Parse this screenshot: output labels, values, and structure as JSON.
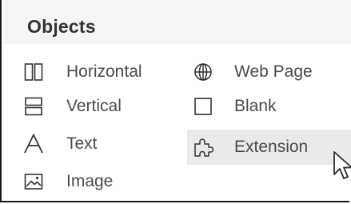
{
  "panel": {
    "title": "Objects"
  },
  "objects": {
    "horizontal": {
      "label": "Horizontal",
      "icon": "horizontal-layout-icon"
    },
    "vertical": {
      "label": "Vertical",
      "icon": "vertical-layout-icon"
    },
    "text": {
      "label": "Text",
      "icon": "text-icon"
    },
    "image": {
      "label": "Image",
      "icon": "image-icon"
    },
    "web_page": {
      "label": "Web Page",
      "icon": "globe-icon"
    },
    "blank": {
      "label": "Blank",
      "icon": "blank-icon"
    },
    "extension": {
      "label": "Extension",
      "icon": "puzzle-piece-icon",
      "hovered": true
    }
  },
  "colors": {
    "hover_background": "#eaeaea",
    "text": "#4a4a4a",
    "icon": "#333333"
  }
}
